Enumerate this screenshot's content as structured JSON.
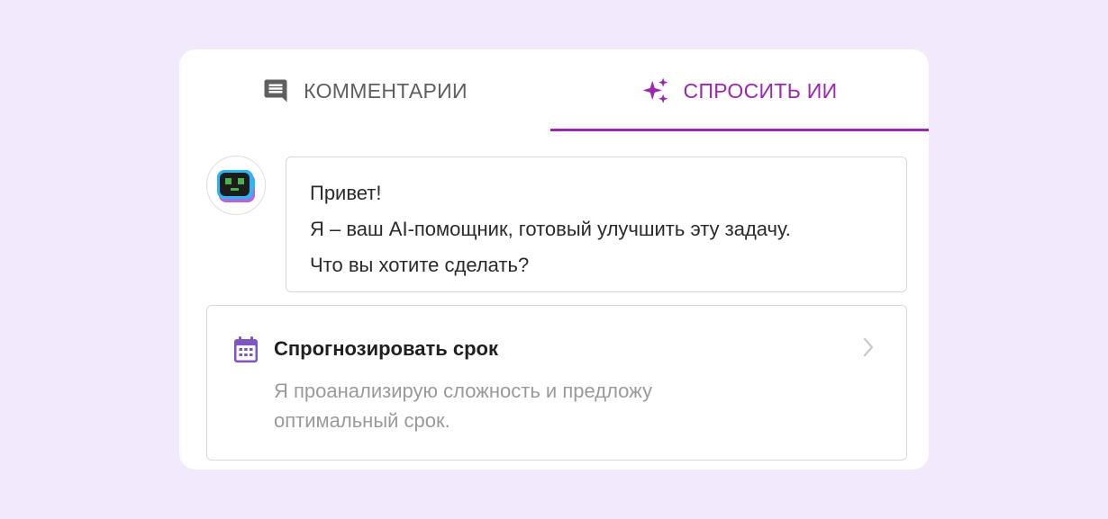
{
  "tabs": {
    "comments": {
      "label": "КОММЕНТАРИИ",
      "icon": "comment-icon"
    },
    "ai": {
      "label": "СПРОСИТЬ ИИ",
      "icon": "sparkles-icon",
      "active": true
    }
  },
  "chat": {
    "avatar_icon": "robot-icon",
    "message_lines": [
      "Привет!",
      "Я – ваш AI-помощник, готовый улучшить эту задачу.",
      "Что вы хотите сделать?"
    ]
  },
  "suggestion": {
    "icon": "calendar-icon",
    "title": "Спрогнозировать срок",
    "description": "Я проанализирую сложность и предложу оптимальный срок."
  },
  "colors": {
    "background": "#f3e9fc",
    "accent": "#9c27b0",
    "calendar": "#7e57c2"
  }
}
